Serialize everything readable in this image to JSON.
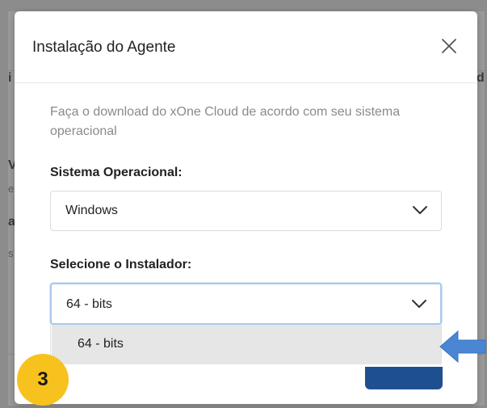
{
  "background": {
    "fragments": [
      "i",
      "d",
      "V",
      "e",
      "a",
      "s"
    ]
  },
  "modal": {
    "title": "Instalação do Agente",
    "close_icon": "close-icon",
    "description": "Faça o download do xOne Cloud de acordo com seu sistema operacional"
  },
  "os_field": {
    "label": "Sistema Operacional:",
    "value": "Windows",
    "icon": "chevron-down-icon"
  },
  "installer_field": {
    "label": "Selecione o Instalador:",
    "value": "64 - bits",
    "icon": "chevron-down-icon",
    "options": [
      "64 - bits"
    ]
  },
  "annotation": {
    "step": "3",
    "badge_color": "#f7c21e",
    "arrow_color": "#4a86d4"
  }
}
